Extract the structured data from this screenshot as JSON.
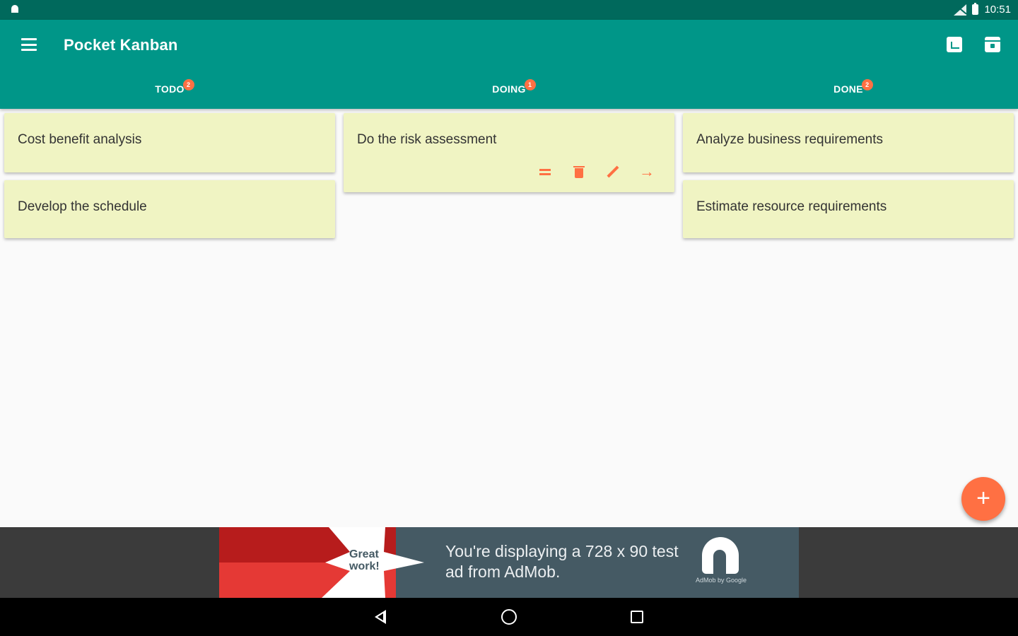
{
  "status_bar": {
    "time": "10:51"
  },
  "app_bar": {
    "title": "Pocket Kanban"
  },
  "tabs": [
    {
      "label": "TODO",
      "badge": "2"
    },
    {
      "label": "DOING",
      "badge": "1"
    },
    {
      "label": "DONE",
      "badge": "2"
    }
  ],
  "columns": {
    "todo": {
      "cards": [
        "Cost benefit analysis",
        "Develop the schedule"
      ]
    },
    "doing": {
      "cards": [
        "Do the risk assessment"
      ]
    },
    "done": {
      "cards": [
        "Analyze business requirements",
        "Estimate resource requirements"
      ]
    }
  },
  "fab": {
    "label": "+"
  },
  "ad": {
    "badge_text": "Great work!",
    "text": "You're displaying a 728 x 90 test ad from AdMob.",
    "caption": "AdMob by Google"
  },
  "colors": {
    "status_bar": "#00695c",
    "app_bar": "#009688",
    "accent": "#ff7043",
    "card": "#f0f4c3",
    "background": "#fafafa"
  },
  "icons": [
    "android-icon",
    "signal-icon",
    "battery-icon",
    "menu-icon",
    "chart-icon",
    "archive-icon",
    "drag-handle-icon",
    "delete-icon",
    "edit-icon",
    "arrow-forward-icon",
    "add-icon",
    "back-icon",
    "home-icon",
    "recents-icon"
  ]
}
